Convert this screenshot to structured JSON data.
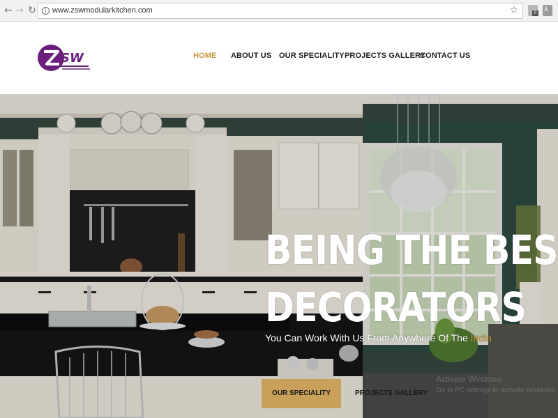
{
  "browser": {
    "url": "www.zswmodularkitchen.com",
    "icons": {
      "back": "back-arrow-icon",
      "forward": "forward-arrow-icon",
      "reload": "reload-icon",
      "info": "info-icon",
      "bookmark": "star-icon",
      "extension_badge": "0"
    }
  },
  "header": {
    "logo_text": "ZSW",
    "brand_color": "#6b1f7c",
    "nav": [
      {
        "label": "HOME",
        "active": true
      },
      {
        "label": "ABOUT US",
        "active": false
      },
      {
        "label": "OUR SPECIALITY",
        "active": false
      },
      {
        "label": "PROJECTS GALLERY",
        "active": false
      },
      {
        "label": "CONTACT US",
        "active": false
      }
    ],
    "active_color": "#c8963e"
  },
  "hero": {
    "title_line1": "BEING THE BEST",
    "title_line2": "DECORATORS",
    "subtitle_prefix": "You Can Work With Us From Anywhere Of The ",
    "subtitle_accent": "India",
    "buttons": {
      "primary": "OUR SPECIALITY",
      "secondary": "PROJECTS GALLERY"
    },
    "button_color": "#c8a05a"
  },
  "watermark": {
    "line1": "Activate Windows",
    "line2": "Go to PC settings to activate Windows."
  }
}
